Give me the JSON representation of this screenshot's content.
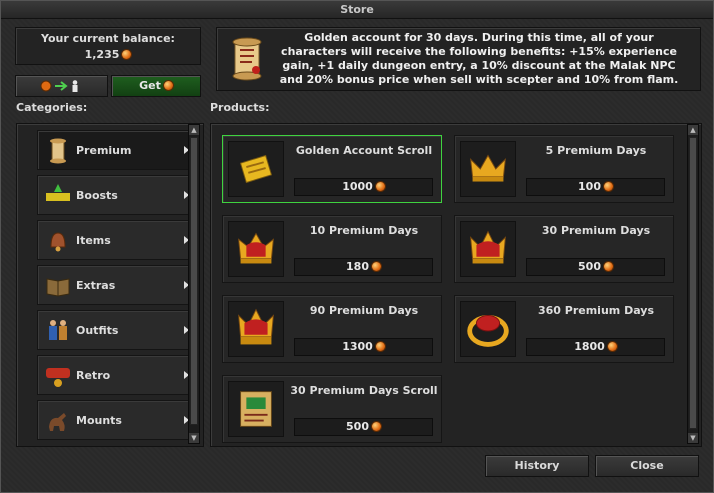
{
  "window": {
    "title": "Store"
  },
  "balance": {
    "label": "Your current balance:",
    "amount": "1,235"
  },
  "actions": {
    "get_label": "Get"
  },
  "description": "Golden account for 30 days. During this time, all of your characters will receive the following benefits: +15% experience gain, +1 daily dungeon entry, a 10% discount at the Malak NPC and 20% bonus price when sell with scepter and 10% from flam.",
  "categories_heading": "Categories:",
  "products_heading": "Products:",
  "categories": [
    {
      "label": "Premium",
      "icon": "scroll-icon",
      "selected": true
    },
    {
      "label": "Boosts",
      "icon": "boosts-icon"
    },
    {
      "label": "Items",
      "icon": "bell-icon"
    },
    {
      "label": "Extras",
      "icon": "book-icon"
    },
    {
      "label": "Outfits",
      "icon": "outfit-icon"
    },
    {
      "label": "Retro",
      "icon": "retro-icon"
    },
    {
      "label": "Mounts",
      "icon": "mount-icon"
    }
  ],
  "products": [
    {
      "name": "Golden Account Scroll",
      "price": "1000",
      "icon": "golden-scroll-icon",
      "selected": true
    },
    {
      "name": "5 Premium Days",
      "price": "100",
      "icon": "crown-icon"
    },
    {
      "name": "10 Premium Days",
      "price": "180",
      "icon": "crown-icon"
    },
    {
      "name": "30 Premium Days",
      "price": "500",
      "icon": "crown-icon"
    },
    {
      "name": "90 Premium Days",
      "price": "1300",
      "icon": "crown-icon"
    },
    {
      "name": "360 Premium Days",
      "price": "1800",
      "icon": "ring-icon"
    },
    {
      "name": "30 Premium Days Scroll",
      "price": "500",
      "icon": "map-scroll-icon"
    }
  ],
  "footer": {
    "history_label": "History",
    "close_label": "Close"
  },
  "colors": {
    "selected_border": "#3fd33f",
    "get_button": "#1f5f1f",
    "coin": "#e06a12"
  }
}
